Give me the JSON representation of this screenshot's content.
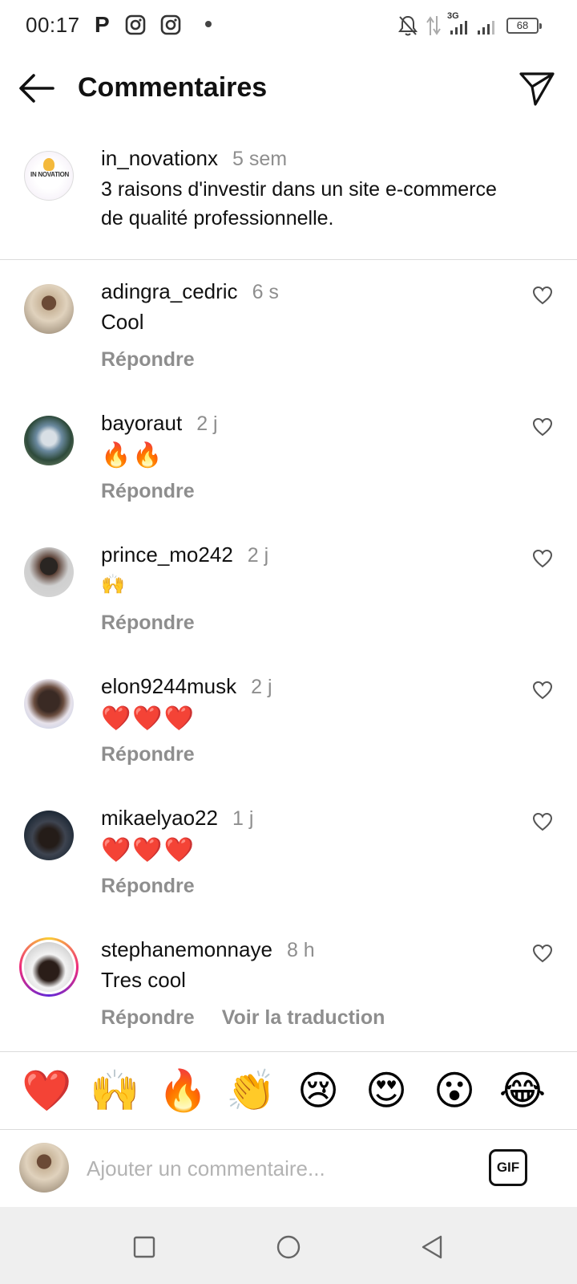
{
  "status_bar": {
    "time": "00:17",
    "p_icon": "P",
    "network": "3G",
    "battery": "68"
  },
  "header": {
    "title": "Commentaires",
    "back_icon": "arrow-left-icon",
    "share_icon": "send-icon"
  },
  "caption": {
    "username": "in_novationx",
    "time": "5 sem",
    "text": "3 raisons d'investir dans un site e-commerce de qualité professionnelle.",
    "avatar_logo": "IN NOVATION"
  },
  "comments": [
    {
      "username": "adingra_cedric",
      "time": "6 s",
      "text": "Cool",
      "reply": "Répondre"
    },
    {
      "username": "bayoraut",
      "time": "2 j",
      "text": "🔥🔥",
      "reply": "Répondre"
    },
    {
      "username": "prince_mo242",
      "time": "2 j",
      "text": "🙌",
      "reply": "Répondre"
    },
    {
      "username": "elon9244musk",
      "time": "2 j",
      "text": "❤️❤️❤️",
      "reply": "Répondre"
    },
    {
      "username": "mikaelyao22",
      "time": "1 j",
      "text": "❤️❤️❤️",
      "reply": "Répondre"
    },
    {
      "username": "stephanemonnaye",
      "time": "8 h",
      "text": "Tres cool",
      "reply": "Répondre",
      "translate": "Voir la traduction"
    }
  ],
  "reactions": [
    "❤️",
    "🙌",
    "🔥",
    "👏",
    "😢",
    "😍",
    "😮",
    "😂"
  ],
  "input": {
    "placeholder": "Ajouter un commentaire...",
    "gif_label": "GIF"
  },
  "colors": {
    "text": "#111111",
    "secondary": "#8e8e8e",
    "divider": "#dbdbdb",
    "nav_bg": "#efefef"
  }
}
